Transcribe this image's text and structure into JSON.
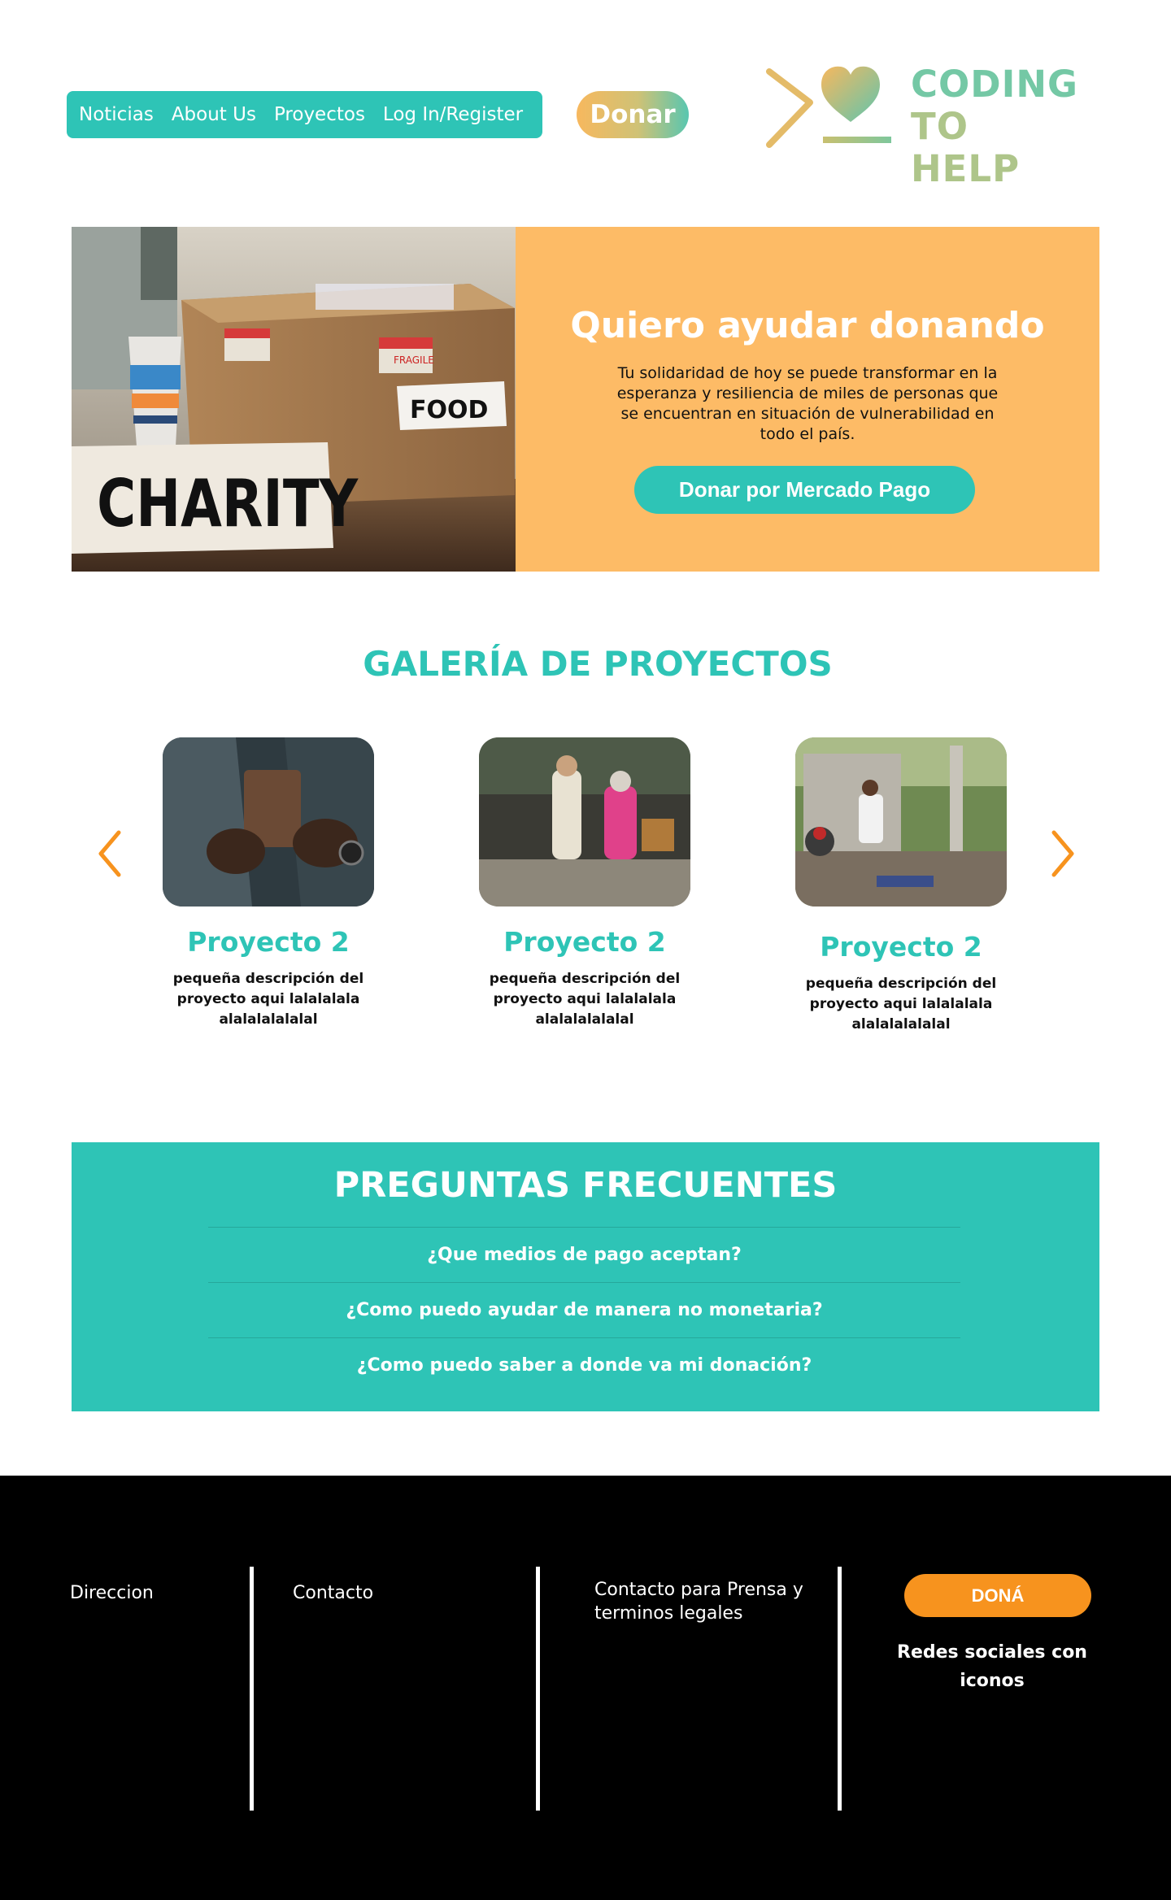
{
  "nav": {
    "items": [
      {
        "label": "Noticias"
      },
      {
        "label": "About Us"
      },
      {
        "label": "Proyectos"
      },
      {
        "label": "Log In/Register"
      }
    ],
    "donate_label": "Donar"
  },
  "logo": {
    "line1": "CODING",
    "line2": "TO HELP",
    "icon": "heart-chevron-icon"
  },
  "hero": {
    "image_text_box": "CHARITY",
    "image_text_food": "FOOD",
    "image_text_fragile": "FRAGILE",
    "title": "Quiero ayudar donando",
    "text": "Tu solidaridad de hoy se puede transformar en la esperanza y resiliencia de miles de personas que se encuentran en situación de vulnerabilidad en todo el país.",
    "button_label": "Donar por Mercado Pago"
  },
  "gallery": {
    "title": "GALERÍA DE PROYECTOS",
    "cards": [
      {
        "title": "Proyecto 2",
        "description": "pequeña descripción del proyecto aqui lalalalala alalalalalalal"
      },
      {
        "title": "Proyecto 2",
        "description": "pequeña descripción del proyecto aqui lalalalala alalalalalalal"
      },
      {
        "title": "Proyecto 2",
        "description": "pequeña descripción del proyecto aqui lalalalala alalalalalalal"
      }
    ],
    "prev_icon": "chevron-left-icon",
    "next_icon": "chevron-right-icon"
  },
  "faq": {
    "title": "PREGUNTAS FRECUENTES",
    "items": [
      {
        "question": "¿Que medios de pago aceptan?"
      },
      {
        "question": "¿Como puedo ayudar de manera no monetaria?"
      },
      {
        "question": "¿Como puedo saber a donde va mi donación?"
      }
    ]
  },
  "footer": {
    "address": "Direccion",
    "contact": "Contacto",
    "press": "Contacto para Prensa y terminos legales",
    "donate_label": "DONÁ",
    "social": "Redes sociales con iconos"
  },
  "colors": {
    "teal": "#2ec4b6",
    "orange": "#fdbb66",
    "accent_orange": "#f7931e",
    "footer_bg": "#000000"
  }
}
